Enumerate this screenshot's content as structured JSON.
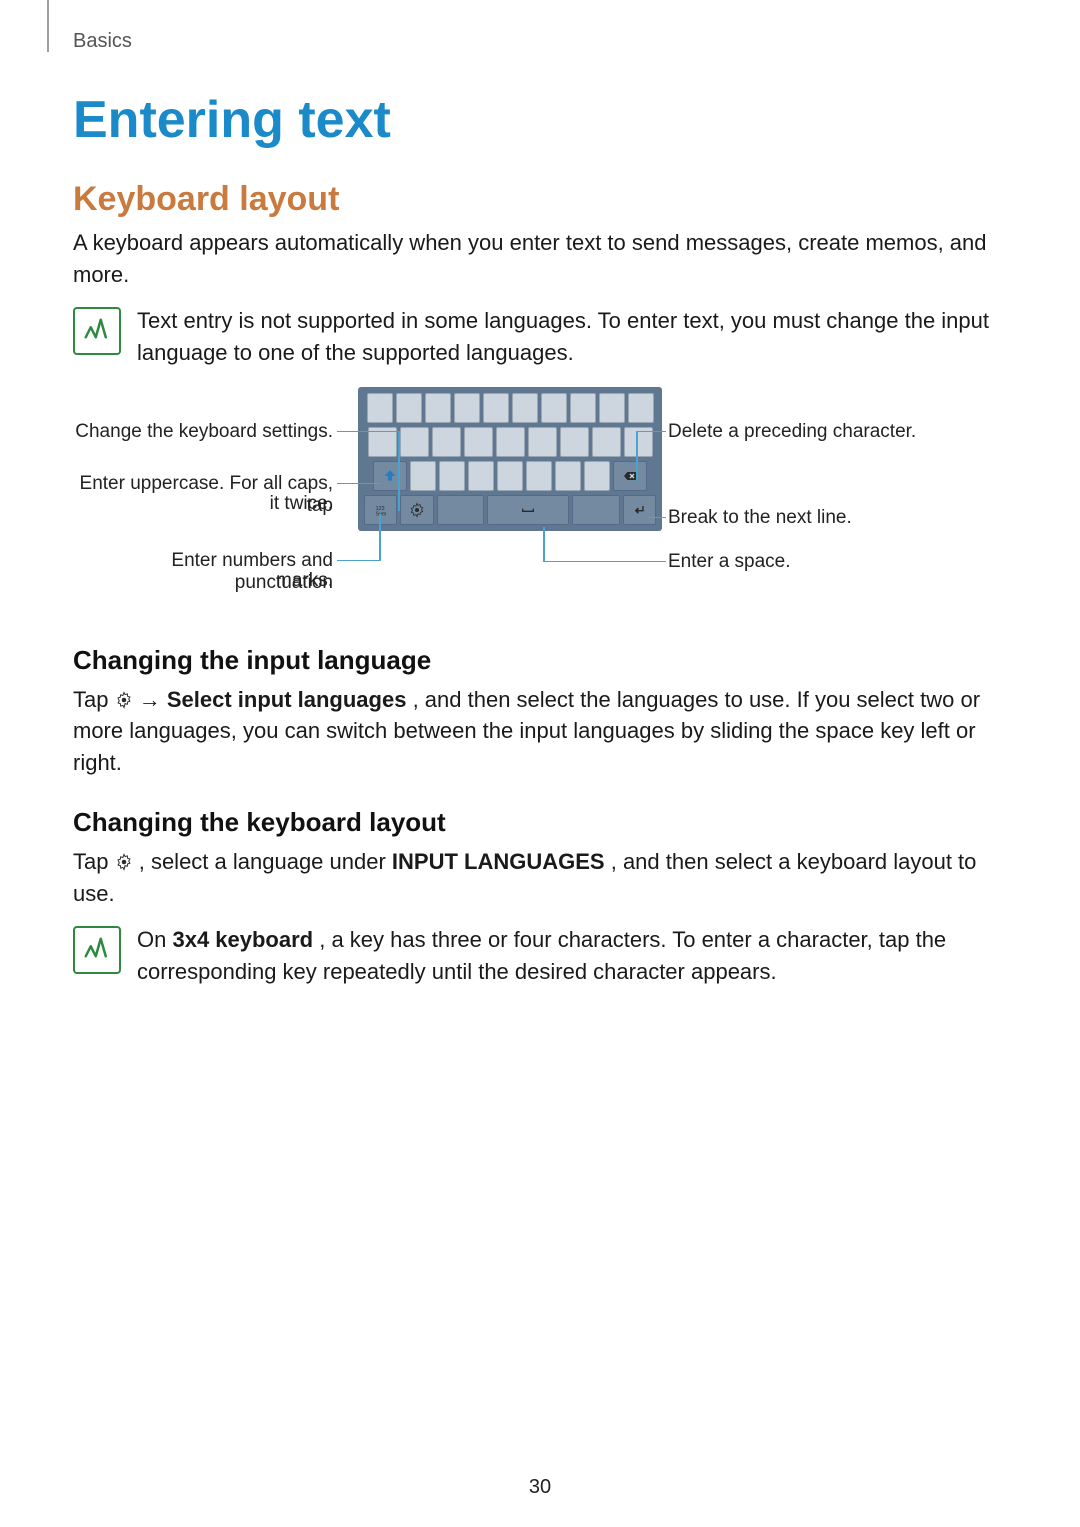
{
  "breadcrumb": "Basics",
  "title": "Entering text",
  "sections": {
    "kbdLayout": {
      "heading": "Keyboard layout",
      "intro": "A keyboard appears automatically when you enter text to send messages, create memos, and more.",
      "note": "Text entry is not supported in some languages. To enter text, you must change the input language to one of the supported languages."
    },
    "labels": {
      "l_settings": "Change the keyboard settings.",
      "l_upper1": "Enter uppercase. For all caps, tap",
      "l_upper2": "it twice.",
      "l_numbers1": "Enter numbers and punctuation",
      "l_numbers2": "marks.",
      "r_delete": "Delete a preceding character.",
      "r_break": "Break to the next line.",
      "r_space": "Enter a space."
    },
    "changeLang": {
      "heading": "Changing the input language",
      "p_a": "Tap ",
      "p_b": " → ",
      "p_bold": "Select input languages",
      "p_c": ", and then select the languages to use. If you select two or more languages, you can switch between the input languages by sliding the space key left or right."
    },
    "changeLayout": {
      "heading": "Changing the keyboard layout",
      "p_a": "Tap ",
      "p_b": ", select a language under ",
      "p_bold": "INPUT LANGUAGES",
      "p_c": ", and then select a keyboard layout to use.",
      "note_a": "On ",
      "note_bold": "3x4 keyboard",
      "note_b": ", a key has three or four characters. To enter a character, tap the corresponding key repeatedly until the desired character appears."
    }
  },
  "pageNumber": "30"
}
